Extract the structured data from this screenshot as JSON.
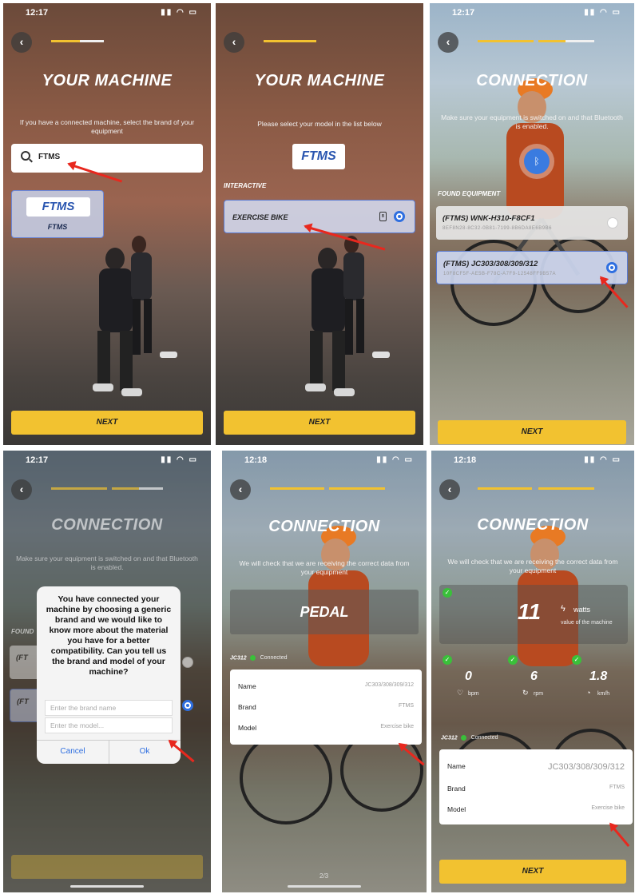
{
  "colors": {
    "accent": "#f2c230",
    "selected": "#2f6fe0",
    "arrow": "#e8281e",
    "check": "#3ac03a"
  },
  "s1": {
    "time": "12:17",
    "title": "YOUR MACHINE",
    "subtitle": "If you have a connected machine, select the brand of your equipment",
    "search_value": "FTMS",
    "brand_logo": "FTMS",
    "brand_name": "FTMS",
    "next": "NEXT"
  },
  "s2": {
    "title": "YOUR MACHINE",
    "subtitle": "Please select your model in the list below",
    "brand_logo": "FTMS",
    "section": "INTERACTIVE",
    "model": "EXERCISE BIKE",
    "next": "NEXT"
  },
  "s3": {
    "time": "12:17",
    "title": "CONNECTION",
    "subtitle": "Make sure your equipment is switched on and that Bluetooth is enabled.",
    "section": "FOUND EQUIPMENT",
    "equipment": [
      {
        "name": "(FTMS) WNK-H310-F8CF1",
        "id": "8EF8N28-8C32-0B81-7199-8B6DA8E6B9B6"
      },
      {
        "name": "(FTMS) JC303/308/309/312",
        "id": "10F8CF5F-AE5B-F78C-A7F9-12548FF9B57A"
      }
    ],
    "next": "NEXT"
  },
  "s4": {
    "time": "12:17",
    "title": "CONNECTION",
    "subtitle": "Make sure your equipment is switched on and that Bluetooth is enabled.",
    "section": "FOUND",
    "row1": "(FT",
    "row2": "(FT",
    "dialog": {
      "message": "You have connected your machine by choosing a generic brand and we would like to know more about the material you have for a better compatibility. Can you tell us the brand and model of your machine?",
      "brand_placeholder": "Enter the brand name",
      "model_placeholder": "Enter the model...",
      "cancel": "Cancel",
      "ok": "Ok"
    }
  },
  "s5": {
    "time": "12:18",
    "title": "CONNECTION",
    "subtitle": "We will check that we are receiving the correct data from your equipment",
    "pedal": "PEDAL",
    "device": "JC312",
    "connected": "Connected",
    "name_label": "Name",
    "name_value": "JC303/308/309/312",
    "brand_label": "Brand",
    "brand_value": "FTMS",
    "model_label": "Model",
    "model_value": "Exercise bike",
    "page": "2/3"
  },
  "s6": {
    "time": "12:18",
    "title": "CONNECTION",
    "subtitle": "We will check that we are receiving the correct data from your equipment",
    "watts_value": "11",
    "watts_unit": "watts",
    "watts_desc": "value of the machine",
    "bpm_value": "0",
    "bpm_unit": "bpm",
    "rpm_value": "6",
    "rpm_unit": "rpm",
    "kmh_value": "1.8",
    "kmh_unit": "km/h",
    "device": "JC312",
    "connected": "Connected",
    "name_label": "Name",
    "name_value": "JC303/308/309/312",
    "brand_label": "Brand",
    "brand_value": "FTMS",
    "model_label": "Model",
    "model_value": "Exercise bike",
    "next": "NEXT"
  }
}
